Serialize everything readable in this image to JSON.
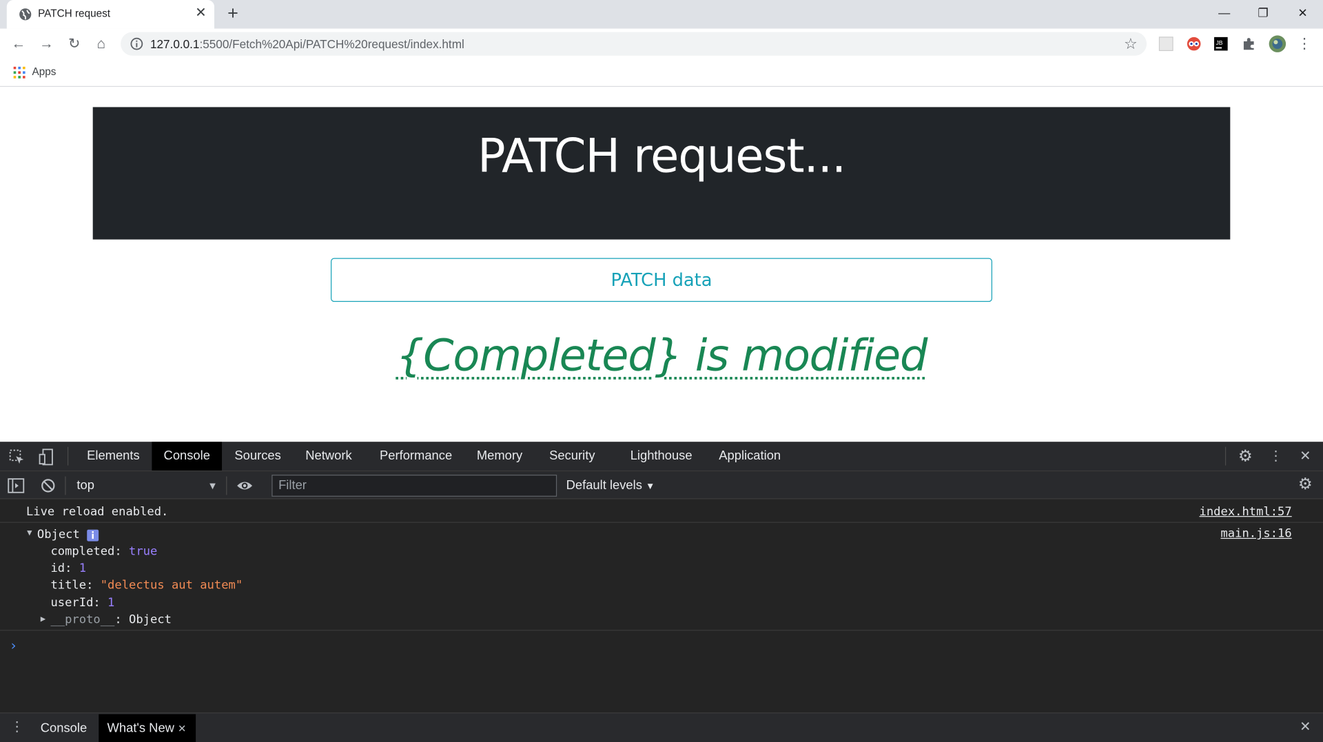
{
  "browser": {
    "tab_title": "PATCH request",
    "url_host": "127.0.0.1",
    "url_path": ":5500/Fetch%20Api/PATCH%20request/index.html",
    "bookmark_apps": "Apps"
  },
  "page": {
    "heading": "PATCH request...",
    "button_label": "PATCH data",
    "status_text": "{Completed} is modified"
  },
  "devtools": {
    "tabs": [
      "Elements",
      "Console",
      "Sources",
      "Network",
      "Performance",
      "Memory",
      "Security",
      "Lighthouse",
      "Application"
    ],
    "active_tab": "Console",
    "context": "top",
    "filter_placeholder": "Filter",
    "levels": "Default levels",
    "console": {
      "message1": "Live reload enabled.",
      "message1_source": "index.html:57",
      "object_label": "Object",
      "object_source": "main.js:16",
      "props": {
        "completed_key": "completed",
        "completed_val": "true",
        "id_key": "id",
        "id_val": "1",
        "title_key": "title",
        "title_val": "\"delectus aut autem\"",
        "userId_key": "userId",
        "userId_val": "1",
        "proto_key": "__proto__",
        "proto_val": "Object"
      }
    },
    "drawer_tabs": [
      "Console",
      "What's New"
    ]
  },
  "colors": {
    "hero_bg": "#212529",
    "button_accent": "#17a2b8",
    "status_green": "#198754",
    "devtools_bg": "#242424"
  }
}
